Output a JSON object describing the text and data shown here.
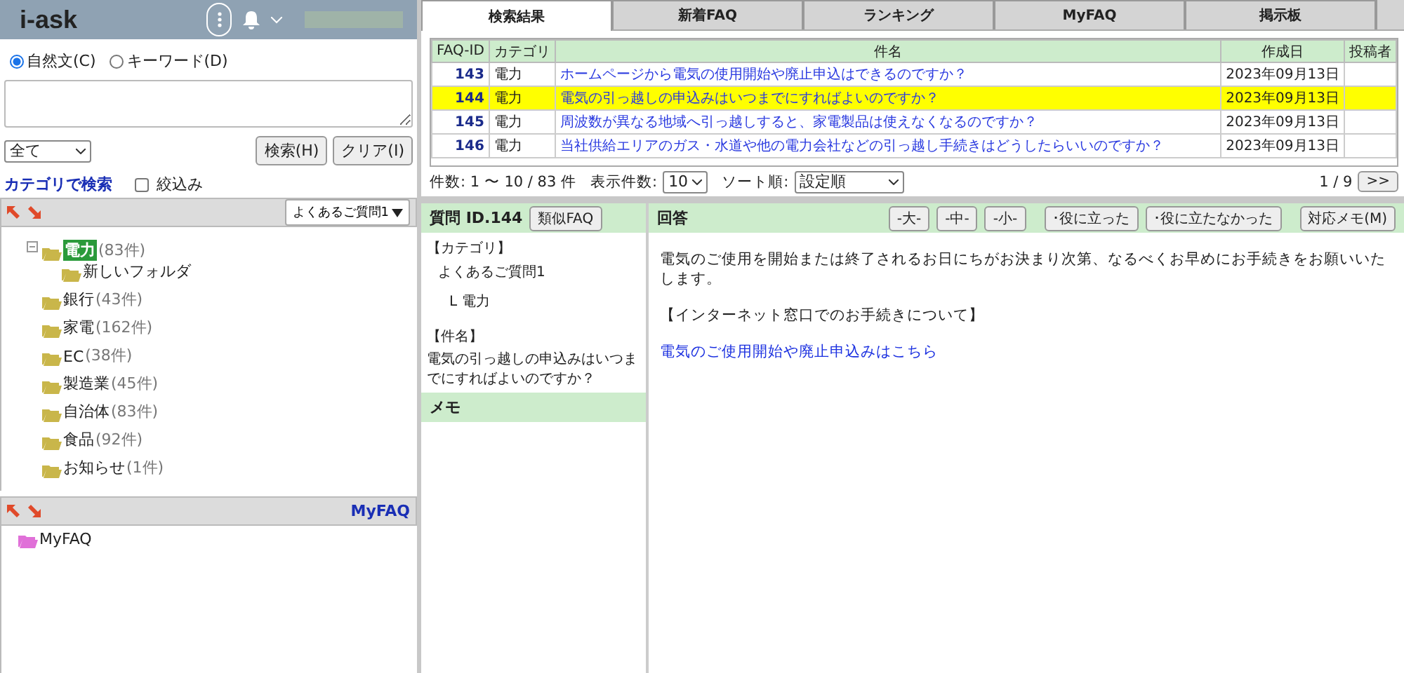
{
  "header": {
    "logo": "i-ask"
  },
  "search": {
    "modes": [
      {
        "label": "自然文(C)",
        "selected": true
      },
      {
        "label": "キーワード(D)",
        "selected": false
      }
    ],
    "scope": "全て",
    "buttons": [
      "検索(H)",
      "クリア(I)"
    ],
    "category_link": "カテゴリで検索",
    "narrow": {
      "label": "絞込み",
      "checked": false
    }
  },
  "category_panel": {
    "dropdown": "よくあるご質問1",
    "tree": [
      {
        "label": "電力",
        "count": "(83件)",
        "selected": true,
        "expanded": true,
        "children": [
          {
            "label": "新しいフォルダ",
            "selected": false
          }
        ]
      },
      {
        "label": "銀行",
        "count": "(43件)",
        "selected": false
      },
      {
        "label": "家電",
        "count": "(162件)",
        "selected": false
      },
      {
        "label": "EC",
        "count": "(38件)",
        "selected": false
      },
      {
        "label": "製造業",
        "count": "(45件)",
        "selected": false
      },
      {
        "label": "自治体",
        "count": "(83件)",
        "selected": false
      },
      {
        "label": "食品",
        "count": "(92件)",
        "selected": false
      },
      {
        "label": "お知らせ",
        "count": "(1件)",
        "selected": false
      }
    ]
  },
  "myfaq_panel": {
    "title": "MyFAQ",
    "tree": [
      {
        "label": "MyFAQ"
      }
    ]
  },
  "tabs": [
    {
      "label": "検索結果",
      "selected": true
    },
    {
      "label": "新着FAQ",
      "selected": false
    },
    {
      "label": "ランキング",
      "selected": false
    },
    {
      "label": "MyFAQ",
      "selected": false
    },
    {
      "label": "掲示板",
      "selected": false
    }
  ],
  "table": {
    "columns": [
      "FAQ-ID",
      "カテゴリ",
      "件名",
      "作成日",
      "投稿者"
    ],
    "rows": [
      {
        "id": "143",
        "category": "電力",
        "title": "ホームページから電気の使用開始や廃止申込はできるのですか？",
        "date": "2023年09月13日",
        "selected": false
      },
      {
        "id": "144",
        "category": "電力",
        "title": "電気の引っ越しの申込みはいつまでにすればよいのですか？",
        "date": "2023年09月13日",
        "selected": true
      },
      {
        "id": "145",
        "category": "電力",
        "title": "周波数が異なる地域へ引っ越しすると、家電製品は使えなくなるのですか？",
        "date": "2023年09月13日",
        "selected": false
      },
      {
        "id": "146",
        "category": "電力",
        "title": "当社供給エリアのガス・水道や他の電力会社などの引っ越し手続きはどうしたらいいのですか？",
        "date": "2023年09月13日",
        "selected": false
      }
    ]
  },
  "pagination": {
    "count": "件数: 1 〜 10 / 83 件",
    "per_page_label": "表示件数:",
    "per_page": "10",
    "sort_label": "ソート順:",
    "sort": "設定順",
    "page": "1 / 9",
    "next": ">>"
  },
  "question": {
    "title": "質問 ID.144",
    "similar_button": "類似FAQ",
    "category_label": "【カテゴリ】",
    "category_path": [
      "よくあるご質問1",
      "L 電力"
    ],
    "subject_label": "【件名】",
    "subject": "電気の引っ越しの申込みはいつまでにすればよいのですか？",
    "memo_label": "メモ"
  },
  "answer": {
    "title": "回答",
    "buttons": [
      "-大-",
      "-中-",
      "-小-",
      "･役に立った",
      "･役に立たなかった",
      "対応メモ(M)"
    ],
    "paragraphs": [
      {
        "kind": "text",
        "text": "電気のご使用を開始または終了されるお日にちがお決まり次第、なるべくお早めにお手続きをお願いいたします。"
      },
      {
        "kind": "text",
        "text": "【インターネット窓口でのお手続きについて】"
      },
      {
        "kind": "link",
        "text": "電気のご使用開始や廃止申込みはこちら"
      }
    ]
  }
}
